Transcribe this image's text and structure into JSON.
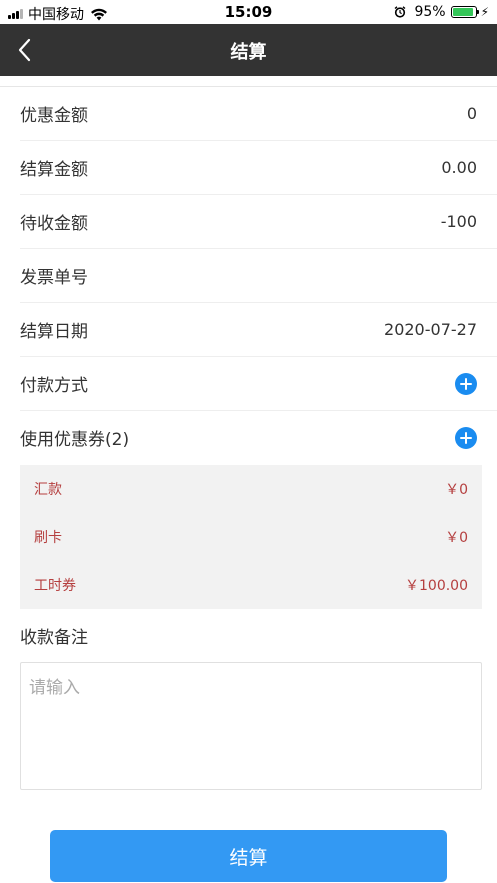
{
  "status_bar": {
    "carrier": "中国移动",
    "time": "15:09",
    "battery": "95%",
    "battery_level": 0.95,
    "icons": [
      "signal-icon",
      "wifi-icon",
      "alarm-icon",
      "battery-icon",
      "charging-icon"
    ]
  },
  "nav": {
    "title": "结算",
    "back_icon": "chevron-left-icon"
  },
  "rows": [
    {
      "label": "优惠金额",
      "value": "0"
    },
    {
      "label": "结算金额",
      "value": "0.00"
    },
    {
      "label": "待收金额",
      "value": "-100"
    },
    {
      "label": "发票单号",
      "value": ""
    },
    {
      "label": "结算日期",
      "value": "2020-07-27"
    },
    {
      "label": "付款方式",
      "action_icon": "plus-circle-icon"
    },
    {
      "label": "使用优惠券(2)",
      "action_icon": "plus-circle-icon"
    }
  ],
  "payment_details": [
    {
      "label": "汇款",
      "amount": "￥0"
    },
    {
      "label": "刷卡",
      "amount": "￥0"
    },
    {
      "label": "工时券",
      "amount": "￥100.00"
    }
  ],
  "remark": {
    "label": "收款备注",
    "placeholder": "请输入",
    "value": ""
  },
  "submit": {
    "label": "结算"
  },
  "colors": {
    "nav_bg": "#333333",
    "accent_blue": "#1a8cf0",
    "submit_blue": "#3399f3",
    "detail_text": "#b53f3f",
    "detail_bg": "#f2f2f2"
  }
}
